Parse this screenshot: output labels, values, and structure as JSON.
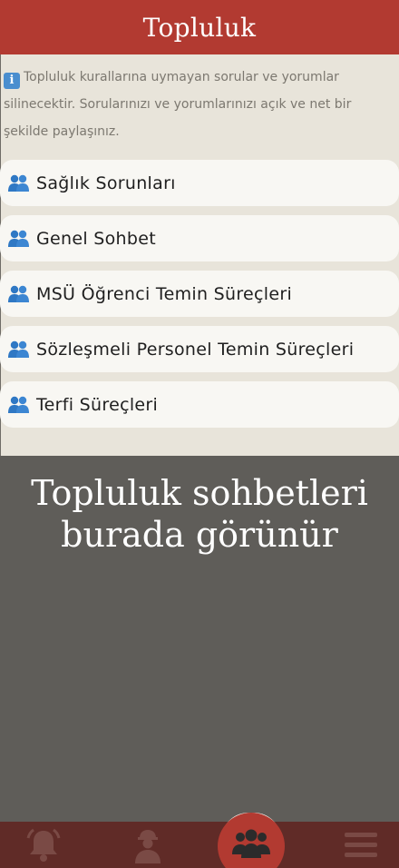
{
  "header": {
    "title": "Topluluk"
  },
  "notice": {
    "icon": "info-icon",
    "text": "Topluluk kurallarına uymayan sorular ve yorumlar silinecektir. Sorularınızı ve yorumlarınızı açık ve net bir şekilde paylaşınız."
  },
  "rooms": [
    {
      "label": "Sağlık Sorunları",
      "icon": "group-icon"
    },
    {
      "label": "Genel Sohbet",
      "icon": "group-icon"
    },
    {
      "label": "MSÜ Öğrenci Temin Süreçleri",
      "icon": "group-icon"
    },
    {
      "label": "Sözleşmeli Personel Temin Süreçleri",
      "icon": "group-icon"
    },
    {
      "label": "Terfi Süreçleri",
      "icon": "group-icon"
    }
  ],
  "overlay": {
    "text": "Topluluk sohbetleri burada görünür"
  },
  "tabbar": {
    "items": [
      {
        "icon": "bell-icon"
      },
      {
        "icon": "soldier-icon"
      },
      {
        "icon": "community-icon",
        "active": true
      },
      {
        "icon": "menu-icon"
      }
    ]
  },
  "colors": {
    "header": "#b23a31",
    "background": "#e8e4da",
    "card": "#f8f7f3",
    "overlay": "#5f5d59",
    "tabbar": "#602b27",
    "group_icon": "#2f78c4"
  }
}
